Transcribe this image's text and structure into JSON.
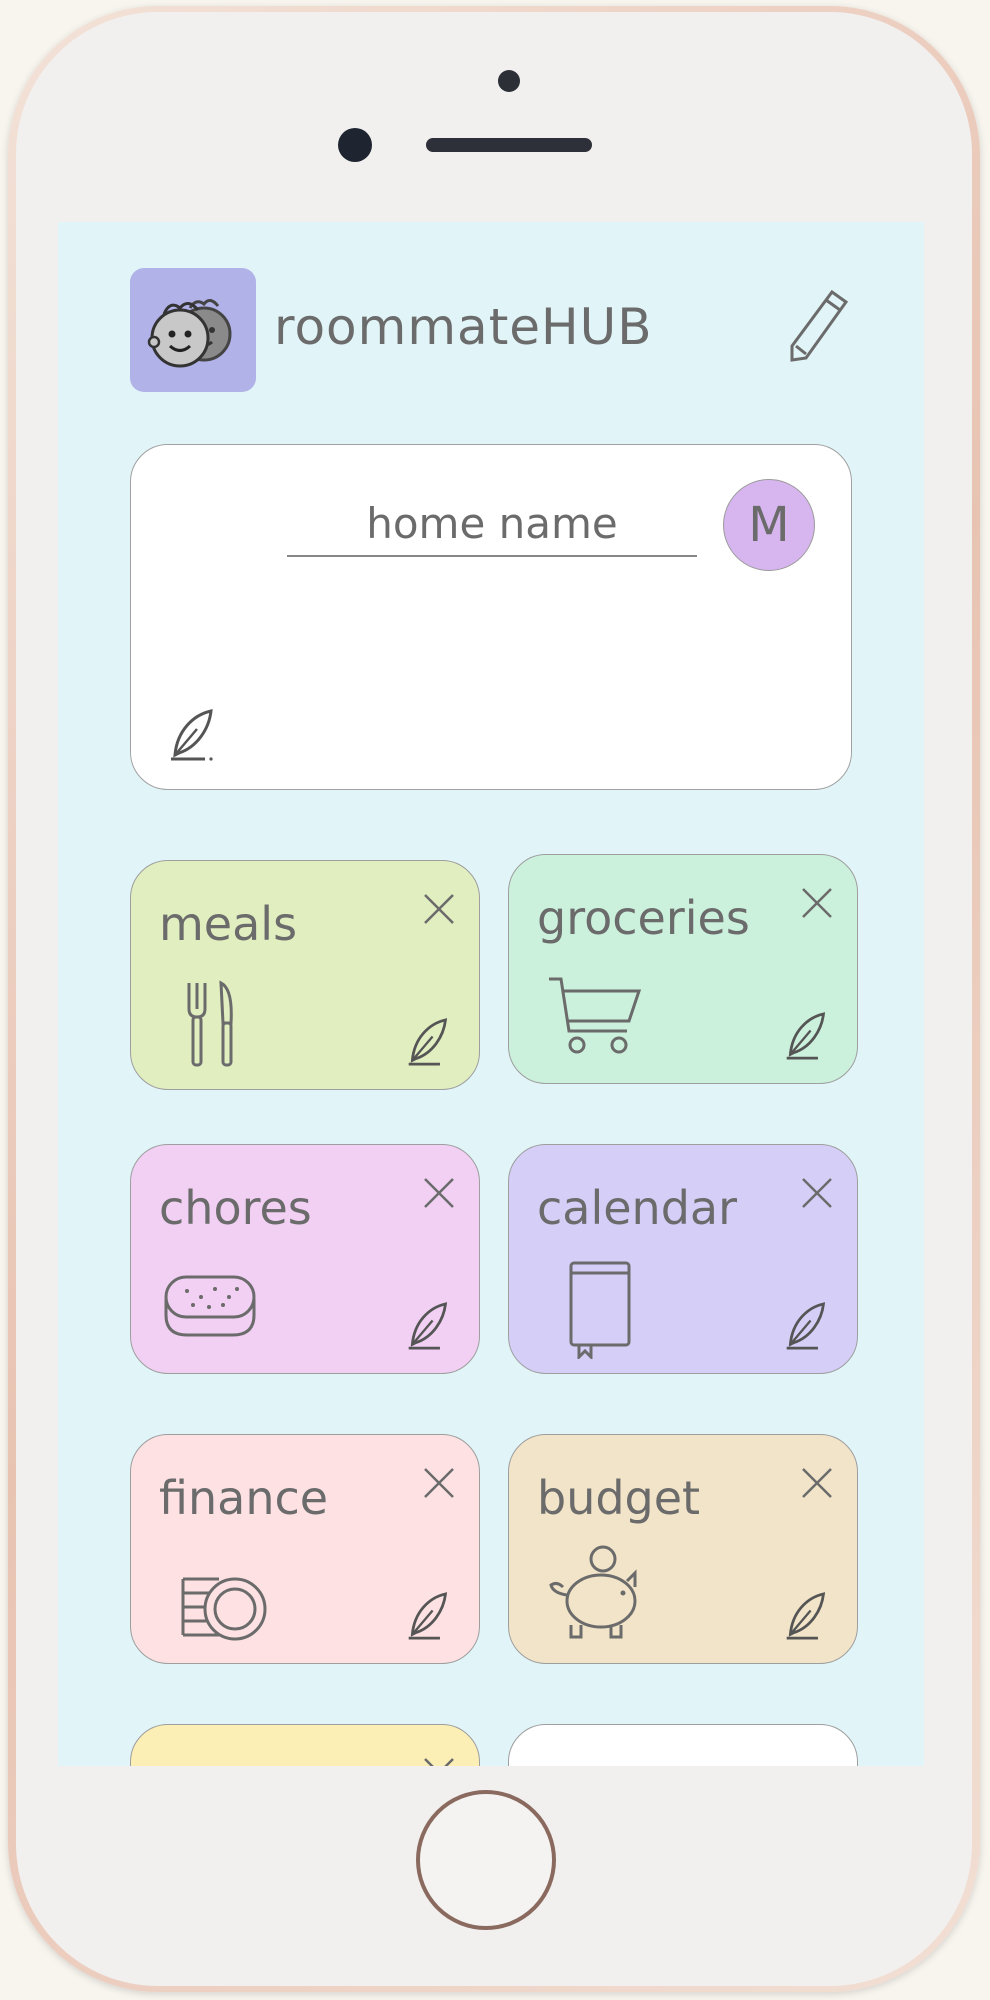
{
  "app": {
    "title": "roommateHUB"
  },
  "home": {
    "name_placeholder": "home name",
    "avatar_letter": "M"
  },
  "tiles": [
    {
      "label": "meals",
      "color": "#e0eec0",
      "icon": "fork-knife-icon"
    },
    {
      "label": "groceries",
      "color": "#cbf1dd",
      "icon": "shopping-cart-icon"
    },
    {
      "label": "chores",
      "color": "#f1d0f3",
      "icon": "sponge-icon"
    },
    {
      "label": "calendar",
      "color": "#d5cff8",
      "icon": "book-icon"
    },
    {
      "label": "finance",
      "color": "#fde1e3",
      "icon": "coins-icon"
    },
    {
      "label": "budget",
      "color": "#f2e4c8",
      "icon": "piggy-bank-icon"
    },
    {
      "label": "",
      "color": "#fbefb6",
      "icon": ""
    },
    {
      "label": "",
      "color": "#ffffff",
      "icon": ""
    }
  ],
  "colors": {
    "screen_bg": "#e1f4f7",
    "logo_bg": "#b1b3e8",
    "avatar_bg": "#d7b6ef",
    "text": "#6b6b6b"
  }
}
